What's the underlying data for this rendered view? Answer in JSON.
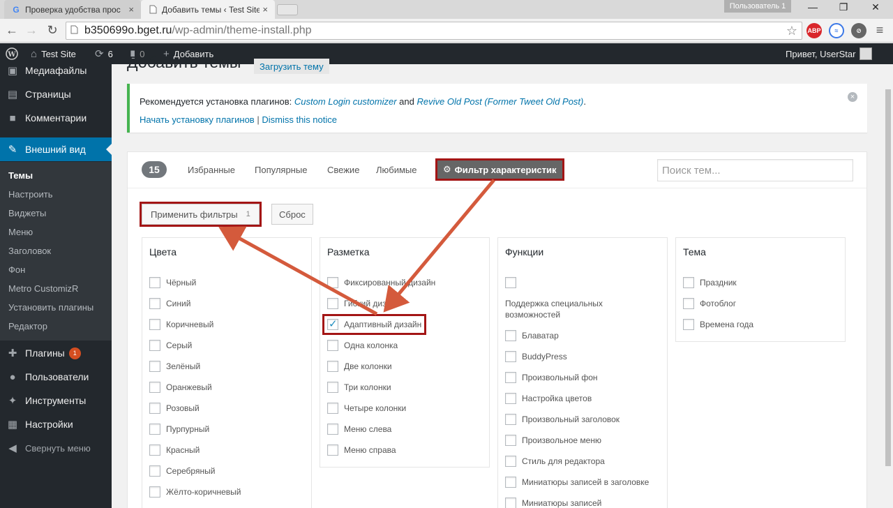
{
  "browser": {
    "tabs": [
      {
        "title": "Проверка удобства прос",
        "favicon": "G"
      },
      {
        "title": "Добавить темы ‹ Test Site",
        "favicon": "doc"
      }
    ],
    "user_badge": "Пользователь 1",
    "url_host": "b350699o.bget.ru",
    "url_path": "/wp-admin/theme-install.php",
    "ext_abp": "ABP"
  },
  "adminbar": {
    "site_name": "Test Site",
    "updates": "6",
    "comments": "0",
    "add_new": "Добавить",
    "greeting": "Привет, UserStar"
  },
  "sidebar": {
    "top_items": [
      {
        "label": "Медиафайлы",
        "icon": "media-icon"
      },
      {
        "label": "Страницы",
        "icon": "pages-icon"
      },
      {
        "label": "Комментарии",
        "icon": "comments-icon"
      }
    ],
    "current": {
      "label": "Внешний вид",
      "icon": "appearance-icon"
    },
    "submenu": [
      "Темы",
      "Настроить",
      "Виджеты",
      "Меню",
      "Заголовок",
      "Фон",
      "Metro CustomizR",
      "Установить плагины",
      "Редактор"
    ],
    "bottom_items": [
      {
        "label": "Плагины",
        "icon": "plugins-icon",
        "badge": "1"
      },
      {
        "label": "Пользователи",
        "icon": "users-icon"
      },
      {
        "label": "Инструменты",
        "icon": "tools-icon"
      },
      {
        "label": "Настройки",
        "icon": "settings-icon"
      }
    ],
    "collapse": "Свернуть меню"
  },
  "main": {
    "title": "Добавить темы",
    "upload_button": "Загрузить тему",
    "notice": {
      "text": "Рекомендуется установка плагинов:",
      "plugin1": "Custom Login customizer",
      "and": "and",
      "plugin2": "Revive Old Post (Former Tweet Old Post)",
      "period": ".",
      "begin_link": "Начать установку плагинов",
      "separator": "|",
      "dismiss_link": "Dismiss this notice"
    },
    "filter": {
      "count": "15",
      "tabs": [
        "Избранные",
        "Популярные",
        "Свежие",
        "Любимые"
      ],
      "feature_filter": "Фильтр характеристик",
      "search_placeholder": "Поиск тем...",
      "apply_label": "Применить фильтры",
      "apply_count": "1",
      "reset_label": "Сброс"
    },
    "groups": {
      "colors": {
        "title": "Цвета",
        "options": [
          "Чёрный",
          "Синий",
          "Коричневый",
          "Серый",
          "Зелёный",
          "Оранжевый",
          "Розовый",
          "Пурпурный",
          "Красный",
          "Серебряный",
          "Жёлто-коричневый"
        ]
      },
      "layout": {
        "title": "Разметка",
        "options": [
          "Фиксированный дизайн",
          "Гибкий дизайн",
          "Адаптивный дизайн",
          "Одна колонка",
          "Две колонки",
          "Три колонки",
          "Четыре колонки",
          "Меню слева",
          "Меню справа"
        ],
        "checked_index": 2
      },
      "features": {
        "title": "Функции",
        "accessibility": "Поддержка специальных возможностей",
        "options": [
          "Блаватар",
          "BuddyPress",
          "Произвольный фон",
          "Настройка цветов",
          "Произвольный заголовок",
          "Произвольное меню",
          "Стиль для редактора",
          "Миниатюры записей в заголовке",
          "Миниатюры записей"
        ]
      },
      "subject": {
        "title": "Тема",
        "options": [
          "Праздник",
          "Фотоблог",
          "Времена года"
        ]
      }
    }
  },
  "colors": {
    "highlight": "#a31515",
    "wp_blue": "#0073aa",
    "admin_dark": "#23282d",
    "notice_green": "#46b450",
    "badge_orange": "#d54e21"
  }
}
